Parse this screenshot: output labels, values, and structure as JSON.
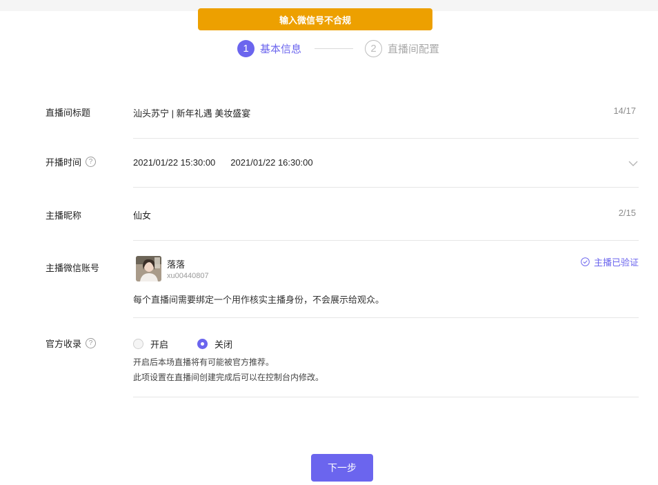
{
  "toast": {
    "message": "输入微信号不合规"
  },
  "steps": [
    {
      "number": "1",
      "label": "基本信息",
      "state": "active"
    },
    {
      "number": "2",
      "label": "直播间配置",
      "state": "inactive"
    }
  ],
  "form": {
    "title": {
      "label": "直播间标题",
      "value": "汕头苏宁 | 新年礼遇 美妆盛宴",
      "counter": "14/17"
    },
    "time": {
      "label": "开播时间",
      "start": "2021/01/22 15:30:00",
      "end": "2021/01/22 16:30:00"
    },
    "nickname": {
      "label": "主播昵称",
      "value": "仙女",
      "counter": "2/15"
    },
    "wechat": {
      "label": "主播微信账号",
      "name": "落落",
      "id": "xu00440807",
      "verified": "主播已验证",
      "hint": "每个直播间需要绑定一个用作核实主播身份，不会展示给观众。"
    },
    "official": {
      "label": "官方收录",
      "options": [
        "开启",
        "关闭"
      ],
      "selected": "关闭",
      "hint1": "开启后本场直播将有可能被官方推荐。",
      "hint2": "此项设置在直播间创建完成后可以在控制台内修改。"
    }
  },
  "next_button": "下一步",
  "colors": {
    "accent": "#6b65ee",
    "toast": "#eda000"
  }
}
